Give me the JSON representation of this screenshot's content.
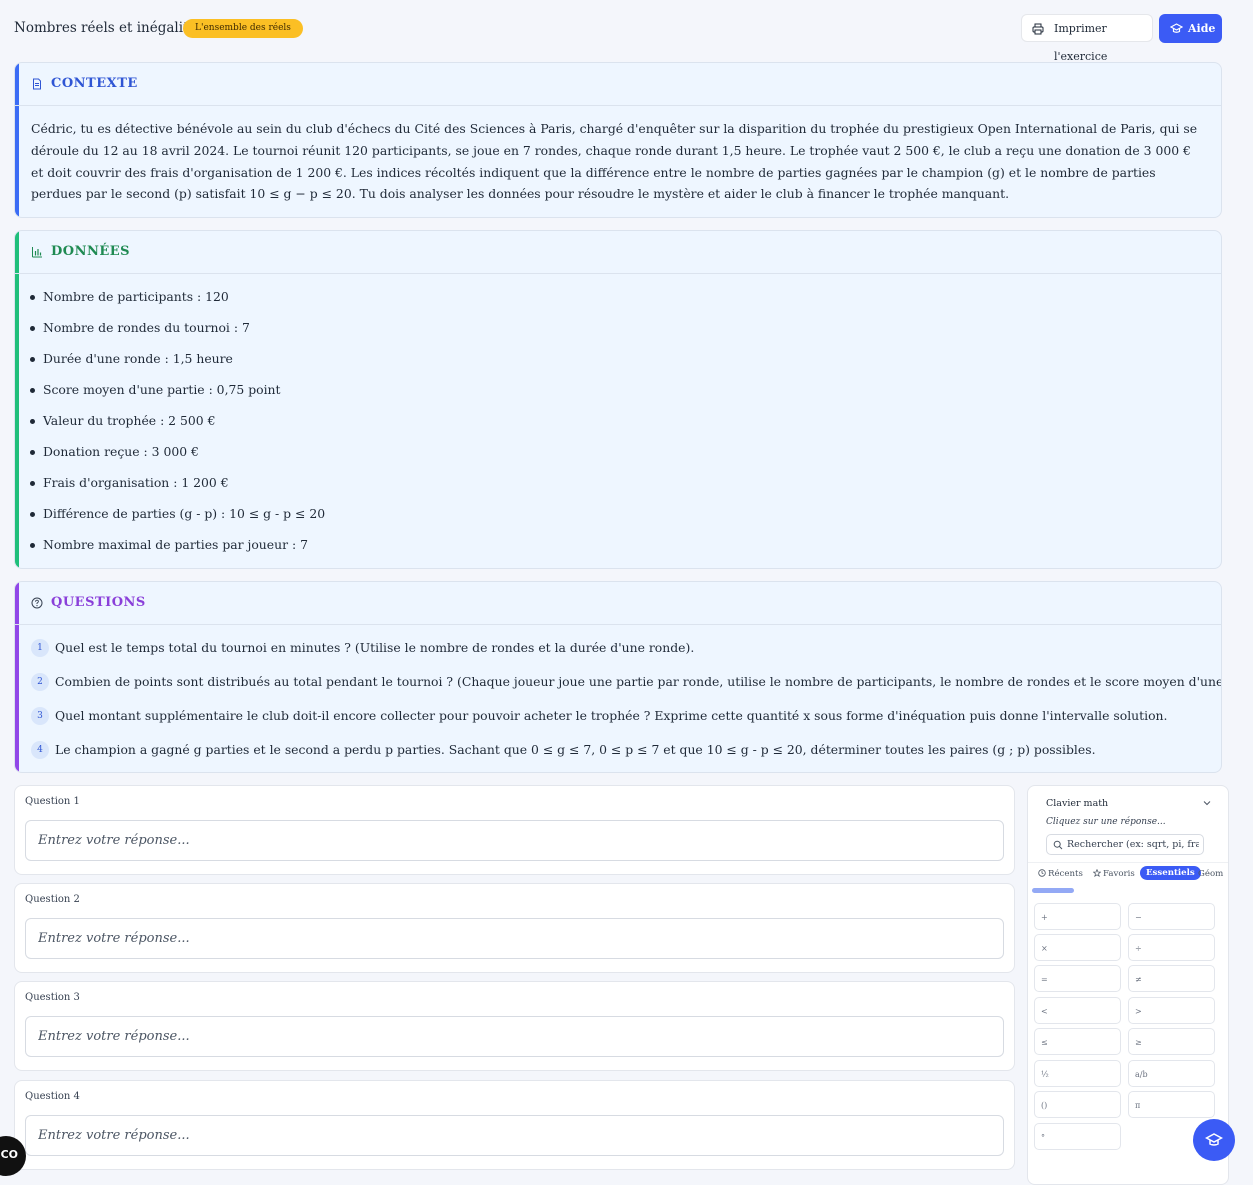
{
  "header": {
    "title": "Nombres réels et inégalités",
    "badge": "L'ensemble des réels",
    "print_label": "Imprimer l'exercice",
    "help_label": "Aide"
  },
  "contexte": {
    "title": "CONTEXTE",
    "text": "Cédric, tu es détective bénévole au sein du club d'échecs du Cité des Sciences à Paris, chargé d'enquêter sur la disparition du trophée du prestigieux Open International de Paris, qui se déroule du 12 au 18 avril 2024. Le tournoi réunit 120 participants, se joue en 7 rondes, chaque ronde durant 1,5 heure. Le trophée vaut 2 500 €, le club a reçu une donation de 3 000 € et doit couvrir des frais d'organisation de 1 200 €. Les indices récoltés indiquent que la différence entre le nombre de parties gagnées par le champion (g) et le nombre de parties perdues par le second (p) satisfait 10 ≤ g − p ≤ 20. Tu dois analyser les données pour résoudre le mystère et aider le club à financer le trophée manquant."
  },
  "donnees": {
    "title": "DONNÉES",
    "items": [
      "Nombre de participants : 120",
      "Nombre de rondes du tournoi : 7",
      "Durée d'une ronde : 1,5 heure",
      "Score moyen d'une partie : 0,75 point",
      "Valeur du trophée : 2 500 €",
      "Donation reçue : 3 000 €",
      "Frais d'organisation : 1 200 €",
      "Différence de parties (g - p) : 10 ≤ g - p ≤ 20",
      "Nombre maximal de parties par joueur : 7"
    ]
  },
  "questions": {
    "title": "QUESTIONS",
    "items": [
      {
        "num": "1",
        "text": "Quel est le temps total du tournoi en minutes ? (Utilise le nombre de rondes et la durée d'une ronde)."
      },
      {
        "num": "2",
        "text": "Combien de points sont distribués au total pendant le tournoi ? (Chaque joueur joue une partie par ronde, utilise le nombre de participants, le nombre de rondes et le score moyen d'une partie)."
      },
      {
        "num": "3",
        "text": "Quel montant supplémentaire le club doit-il encore collecter pour pouvoir acheter le trophée ? Exprime cette quantité x sous forme d'inéquation puis donne l'intervalle solution."
      },
      {
        "num": "4",
        "text": "Le champion a gagné g parties et le second a perdu p parties. Sachant que 0 ≤ g ≤ 7, 0 ≤ p ≤ 7 et que 10 ≤ g - p ≤ 20, déterminer toutes les paires (g ; p) possibles."
      }
    ]
  },
  "answers": [
    {
      "label": "Question 1",
      "placeholder": "Entrez votre réponse...",
      "value": ""
    },
    {
      "label": "Question 2",
      "placeholder": "Entrez votre réponse...",
      "value": ""
    },
    {
      "label": "Question 3",
      "placeholder": "Entrez votre réponse...",
      "value": ""
    },
    {
      "label": "Question 4",
      "placeholder": "Entrez votre réponse...",
      "value": ""
    }
  ],
  "keyboard": {
    "title": "Clavier math",
    "hint": "Cliquez sur une réponse...",
    "search_placeholder": "Rechercher (ex: sqrt, pi, fra",
    "tabs": [
      {
        "label": "Récents",
        "icon": "clock-icon",
        "active": false
      },
      {
        "label": "Favoris",
        "icon": "star-icon",
        "active": false
      },
      {
        "label": "Essentiels",
        "icon": "",
        "active": true
      },
      {
        "label": "Géom",
        "icon": "",
        "active": false
      }
    ],
    "keys": [
      "+",
      "−",
      "×",
      "÷",
      "=",
      "≠",
      "<",
      ">",
      "≤",
      "≥",
      "½",
      "a/b",
      "()",
      "π",
      "°"
    ]
  },
  "corner_badge": "CO",
  "colors": {
    "accent": "#3b5bf5",
    "contexte": "#3b6cf5",
    "donnees": "#1fbf7a",
    "questions": "#9147e8",
    "badge": "#fbbf24"
  }
}
